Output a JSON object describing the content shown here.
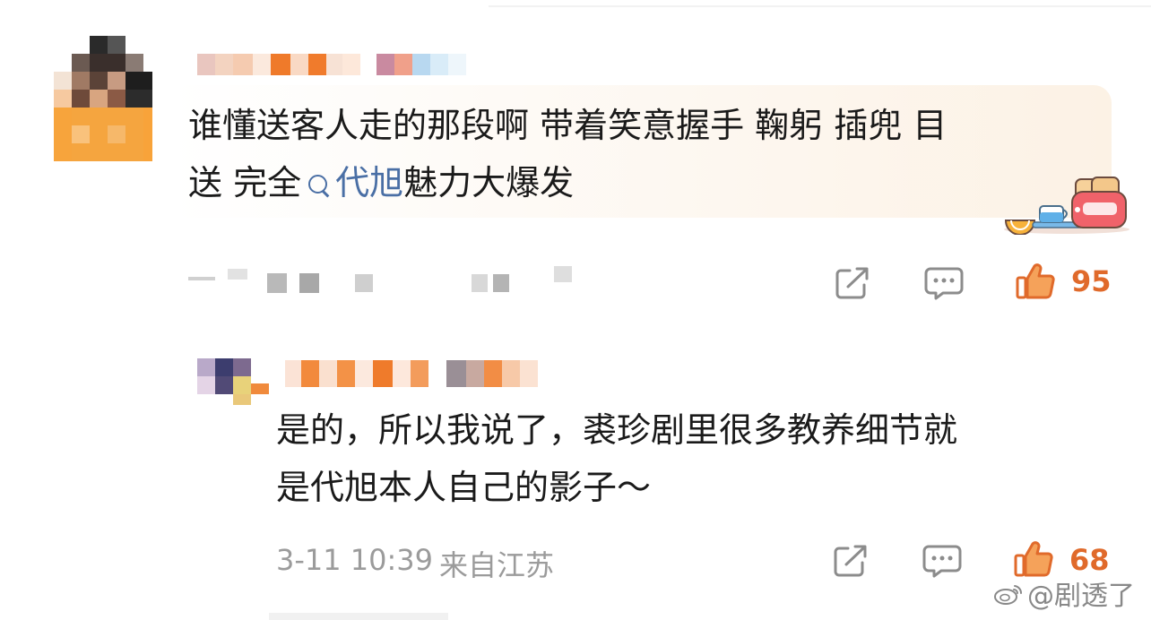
{
  "comments": [
    {
      "text_plain_1": "谁懂送客人走的那段啊 带着笑意握手 鞠躬 插兜 目",
      "text_plain_2": "送 完全",
      "topic": "代旭",
      "text_plain_3": "魅力大爆发",
      "likes": "95",
      "meta_icons": [
        "share-icon",
        "comment-icon",
        "thumbs-up-icon"
      ]
    },
    {
      "text_line_1": "是的，所以我说了，裘珍剧里很多教养细节就",
      "text_line_2": "是代旭本人自己的影子～",
      "date": "3-11 10:39",
      "location": "来自江苏",
      "likes": "68",
      "meta_icons": [
        "share-icon",
        "comment-icon",
        "thumbs-up-icon"
      ]
    }
  ],
  "watermark": {
    "text": "@剧透了"
  },
  "colors": {
    "accent": "#e06a2b",
    "topic_link": "#4a6fa5",
    "meta_gray": "#9b9b9b",
    "text": "#1a1a1a"
  }
}
